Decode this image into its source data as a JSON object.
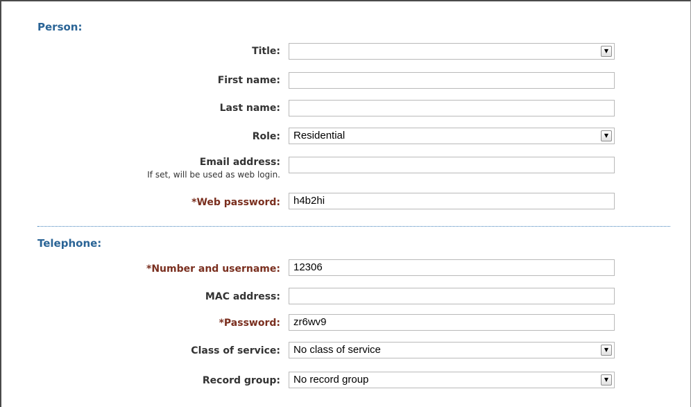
{
  "person": {
    "heading": "Person:",
    "title_label": "Title:",
    "title_value": "",
    "first_name_label": "First name:",
    "first_name_value": "",
    "last_name_label": "Last name:",
    "last_name_value": "",
    "role_label": "Role:",
    "role_value": "Residential",
    "email_label": "Email address:",
    "email_hint": "If set, will be used as web login.",
    "email_value": "",
    "web_password_label": "*Web password:",
    "web_password_value": "h4b2hi"
  },
  "telephone": {
    "heading": "Telephone:",
    "number_label": "*Number and username:",
    "number_value": "12306",
    "mac_label": "MAC address:",
    "mac_value": "",
    "password_label": "*Password:",
    "password_value": "zr6wv9",
    "class_label": "Class of service:",
    "class_value": "No class of service",
    "record_label": "Record group:",
    "record_value": "No record group"
  },
  "icons": {
    "dropdown": "chevron-down-icon"
  },
  "colors": {
    "section_heading": "#2a6496",
    "required_label": "#7a2f1f",
    "divider": "#3d7fb8"
  }
}
